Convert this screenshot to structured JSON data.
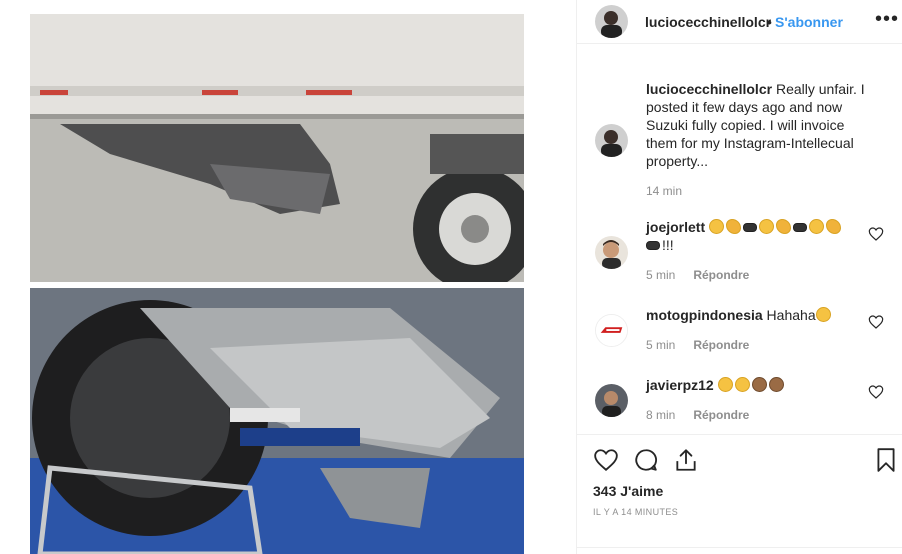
{
  "post": {
    "author": "luciocecchinellolcr",
    "separator": "•",
    "follow_label": "S'abonner",
    "more_label": "•••",
    "caption": {
      "username": "luciocecchinellolcr",
      "text": " Really unfair. I posted it few days ago and now Suzuki fully copied. I will invoice them for my Instagram-Intellecual property...",
      "time": "14 min"
    }
  },
  "comments": [
    {
      "username": "joejorlett",
      "text_suffix": "!!!",
      "emoji": [
        "laughing",
        "muscle",
        "motorbike",
        "laughing",
        "muscle",
        "motorbike",
        "smile",
        "muscle",
        "motorbike"
      ],
      "time": "5 min",
      "reply_label": "Répondre"
    },
    {
      "username": "motogpindonesia",
      "text": " Hahaha",
      "emoji": [
        "laughing"
      ],
      "time": "5 min",
      "reply_label": "Répondre"
    },
    {
      "username": "javierpz12",
      "text": " ",
      "emoji": [
        "laughing",
        "laughing",
        "see-no-evil-monkey",
        "see-no-evil-monkey"
      ],
      "time": "8 min",
      "reply_label": "Répondre"
    }
  ],
  "actions": {
    "likes": "343 J'aime",
    "timestamp": "IL Y A 14 MINUTES"
  },
  "colors": {
    "accent": "#3897f0",
    "text": "#262626",
    "muted": "#8e8e8e",
    "border": "#efefef"
  },
  "icons": {
    "like": "heart-icon",
    "comment": "comment-bubble-icon",
    "share": "share-icon",
    "save": "bookmark-icon",
    "comment_like": "heart-outline-icon"
  }
}
